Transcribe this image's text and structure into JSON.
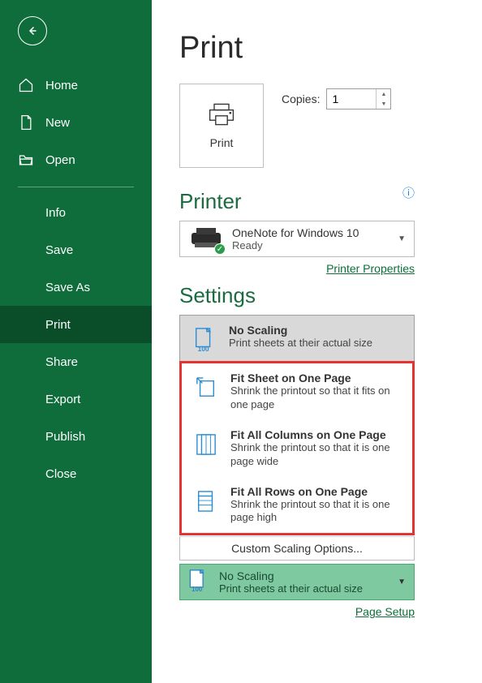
{
  "sidebar": {
    "items": [
      {
        "label": "Home"
      },
      {
        "label": "New"
      },
      {
        "label": "Open"
      },
      {
        "label": "Info"
      },
      {
        "label": "Save"
      },
      {
        "label": "Save As"
      },
      {
        "label": "Print"
      },
      {
        "label": "Share"
      },
      {
        "label": "Export"
      },
      {
        "label": "Publish"
      },
      {
        "label": "Close"
      }
    ]
  },
  "main": {
    "title": "Print",
    "print_button_label": "Print",
    "copies_label": "Copies:",
    "copies_value": "1",
    "printer_heading": "Printer",
    "printer_name": "OneNote for Windows 10",
    "printer_status": "Ready",
    "printer_properties_link": "Printer Properties",
    "settings_heading": "Settings",
    "scaling_options": [
      {
        "title": "No Scaling",
        "desc": "Print sheets at their actual size",
        "icon_text": "100"
      },
      {
        "title": "Fit Sheet on One Page",
        "desc": "Shrink the printout so that it fits on one page"
      },
      {
        "title": "Fit All Columns on One Page",
        "desc": "Shrink the printout so that it is one page wide"
      },
      {
        "title": "Fit All Rows on One Page",
        "desc": "Shrink the printout so that it is one page high"
      }
    ],
    "custom_scaling_label": "Custom Scaling Options...",
    "current_scaling": {
      "title": "No Scaling",
      "desc": "Print sheets at their actual size",
      "icon_text": "100"
    },
    "page_setup_link": "Page Setup"
  }
}
